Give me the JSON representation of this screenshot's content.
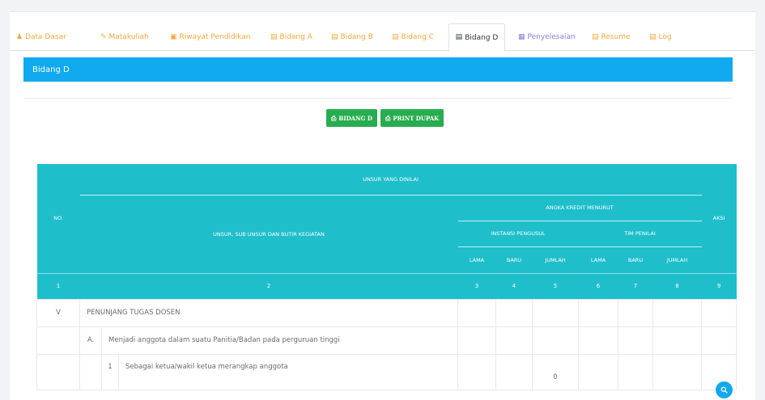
{
  "tabs": [
    {
      "label": "Data Dasar",
      "icon": "user-icon",
      "glyph": "♟",
      "active": false
    },
    {
      "label": "Matakuliah",
      "icon": "edit-icon",
      "glyph": "✎",
      "active": false
    },
    {
      "label": "Riwayat Pendidikan",
      "icon": "book-icon",
      "glyph": "▣",
      "active": false
    },
    {
      "label": "Bidang A",
      "icon": "calendar-icon",
      "glyph": "▤",
      "active": false
    },
    {
      "label": "Bidang B",
      "icon": "calendar-icon",
      "glyph": "▤",
      "active": false
    },
    {
      "label": "Bidang C",
      "icon": "calendar-icon",
      "glyph": "▤",
      "active": false
    },
    {
      "label": "Bidang D",
      "icon": "calendar-icon",
      "glyph": "▤",
      "active": true
    },
    {
      "label": "Penyelesaian",
      "icon": "grid-icon",
      "glyph": "▦",
      "active": false
    },
    {
      "label": "Resume",
      "icon": "calendar-icon",
      "glyph": "▤",
      "active": false
    },
    {
      "label": "Log",
      "icon": "calendar-icon",
      "glyph": "▤",
      "active": false
    }
  ],
  "panel": {
    "title": "Bidang D"
  },
  "buttons": {
    "bidang_d": "BIDANG D",
    "print_dupak": "PRINT DUPAK",
    "icon": "print-icon"
  },
  "table": {
    "headers": {
      "no": "NO.",
      "unsur_dinilai": "UNSUR YANG DINILAI",
      "unsur_sub": "UNSUR, SUB UNSUR DAN BUTIR KEGIATAN",
      "angka_kredit": "ANGKA KREDIT MENURUT",
      "instansi": "INSTANSI PENGUSUL",
      "tim_penilai": "TIM PENILAI",
      "lama": "LAMA",
      "baru": "BARU",
      "jumlah": "JUMLAH",
      "aksi": "AKSI"
    },
    "col_numbers": [
      "1",
      "2",
      "3",
      "4",
      "5",
      "6",
      "7",
      "8",
      "9"
    ],
    "rows": {
      "r1_no": "V",
      "r1_text": "PENUNJANG TUGAS DOSEN",
      "r2_no": "A.",
      "r2_text": "Menjadi anggota dalam suatu Panitia/Badan pada perguruan tinggi",
      "r3_no": "1",
      "r3_text": "Sebagai ketua/wakil ketua merangkap anggota",
      "r3_jumlah": "0"
    },
    "action_icon": "search-icon"
  },
  "colors": {
    "accent": "#11a9f0",
    "header_teal": "#1ebfcb",
    "button_green": "#27ad4f",
    "tab_orange": "#f0a83c"
  }
}
